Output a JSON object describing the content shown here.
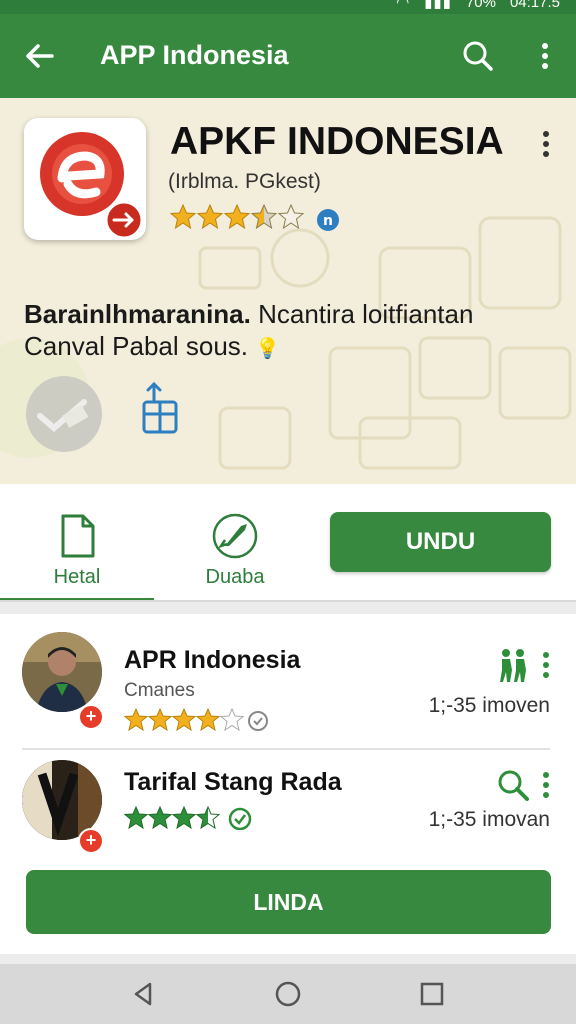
{
  "status_bar": {
    "battery": "70%",
    "time": "04:17.5"
  },
  "app_bar": {
    "title": "APP Indonesia",
    "back_icon": "arrow-left-icon",
    "search_icon": "search-icon",
    "more_icon": "more-vertical-icon"
  },
  "app_header": {
    "name": "APKF INDONESIA",
    "developer": "(Irblma. PGkest)",
    "rating": 3.5,
    "description_bold": "Barainlhmaranina.",
    "description_rest": " Ncantira loitfiantan",
    "description_line2": "Canval Pabal sous.",
    "emoji": "💡"
  },
  "tabs": [
    {
      "label": "Hetal",
      "icon": "document-icon",
      "selected": true
    },
    {
      "label": "Duaba",
      "icon": "rocket-icon",
      "selected": false
    }
  ],
  "primary_button": "UNDU",
  "list": [
    {
      "title": "APR Indonesia",
      "subtitle": "Cmanes",
      "rating": 4,
      "meta": "1;-35 imoven",
      "action_icon": "people-walking-icon"
    },
    {
      "title": "Tarifal Stang Rada",
      "subtitle": "",
      "rating": 3.5,
      "meta": "1;-35 imovan",
      "action_icon": "search-icon"
    }
  ],
  "secondary_button": "LINDA",
  "colors": {
    "primary": "#37893f",
    "star": "#f2b01e",
    "accent_red": "#e53d2a"
  }
}
